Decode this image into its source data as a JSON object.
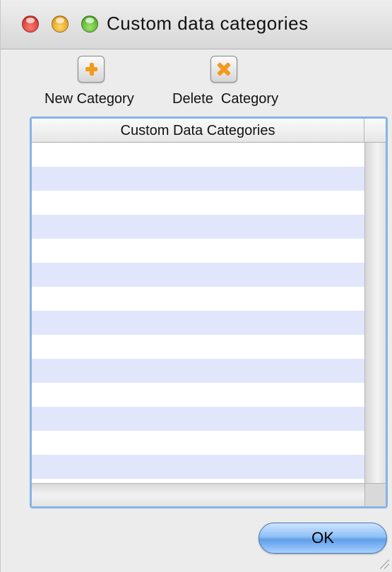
{
  "window": {
    "title": "Custom data categories"
  },
  "toolbar": {
    "new_label": "New Category",
    "new_icon": "plus-icon",
    "delete_label": "Delete  Category",
    "delete_icon": "x-icon"
  },
  "table": {
    "column_header": "Custom Data Categories",
    "rows": []
  },
  "footer": {
    "ok_label": "OK"
  },
  "colors": {
    "row_stripe": "#e2e6fb",
    "focus_ring": "#86b4e6",
    "icon_accent": "#f29a1a",
    "default_button": "#5f9fe8"
  }
}
